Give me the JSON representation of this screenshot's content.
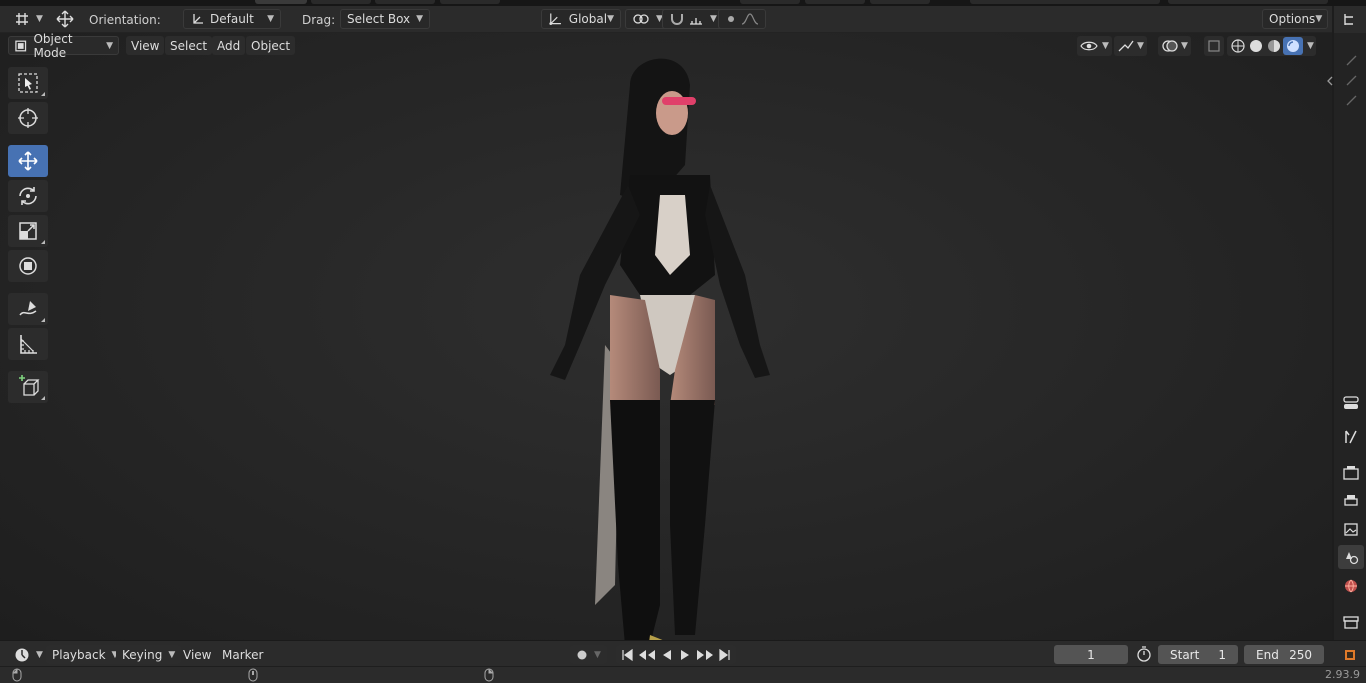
{
  "header": {
    "orientation_label": "Orientation:",
    "orientation_value": "Default",
    "drag_label": "Drag:",
    "drag_value": "Select Box",
    "transform_space": "Global",
    "options_label": "Options"
  },
  "viewport_menu": {
    "mode": "Object Mode",
    "items": [
      "View",
      "Select",
      "Add",
      "Object"
    ]
  },
  "toolbar": {
    "tools": [
      {
        "name": "select-box-tool-icon",
        "active": false
      },
      {
        "name": "cursor-tool-icon",
        "active": false
      },
      {
        "name": "move-tool-icon",
        "active": true
      },
      {
        "name": "rotate-tool-icon",
        "active": false
      },
      {
        "name": "scale-tool-icon",
        "active": false
      },
      {
        "name": "transform-tool-icon",
        "active": false
      },
      {
        "name": "annotate-tool-icon",
        "active": false
      },
      {
        "name": "measure-tool-icon",
        "active": false
      },
      {
        "name": "add-cube-tool-icon",
        "active": false
      }
    ]
  },
  "timeline": {
    "playback_label": "Playback",
    "keying_label": "Keying",
    "view_label": "View",
    "marker_label": "Marker",
    "current_frame": "1",
    "start_label": "Start",
    "start_value": "1",
    "end_label": "End",
    "end_value": "250"
  },
  "status": {
    "version": "2.93.9"
  },
  "colors": {
    "accent": "#4772b3",
    "panel": "#2b2b2b",
    "viewport": "#262626"
  }
}
